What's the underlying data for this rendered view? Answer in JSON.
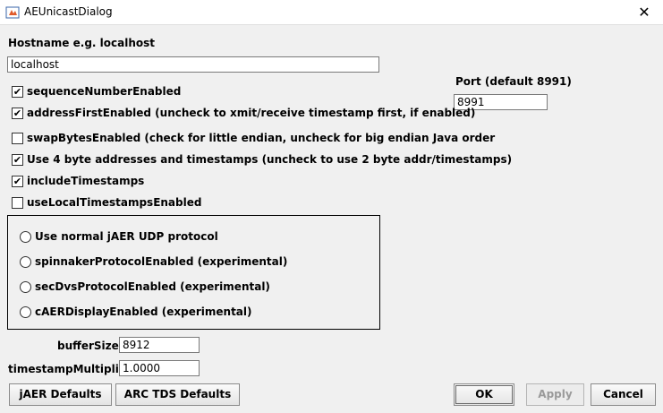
{
  "window": {
    "title": "AEUnicastDialog",
    "close_glyph": "✕"
  },
  "hostname": {
    "label": "Hostname e.g. localhost",
    "value": "localhost"
  },
  "port": {
    "label": "Port (default 8991)",
    "value": "8991"
  },
  "checkboxes": [
    {
      "label": "sequenceNumberEnabled",
      "checked": true
    },
    {
      "label": "addressFirstEnabled (uncheck to xmit/receive timestamp first, if enabled)",
      "checked": true
    },
    {
      "label": "swapBytesEnabled (check for little endian, uncheck for big endian Java order",
      "checked": false
    },
    {
      "label": "Use 4 byte addresses and timestamps (uncheck to use 2 byte addr/timestamps)",
      "checked": true
    },
    {
      "label": "includeTimestamps",
      "checked": true
    },
    {
      "label": "useLocalTimestampsEnabled",
      "checked": false
    }
  ],
  "check_glyph": "✔",
  "protocols": [
    {
      "label": "Use normal jAER UDP protocol",
      "selected": false
    },
    {
      "label": "spinnakerProtocolEnabled (experimental)",
      "selected": false
    },
    {
      "label": "secDvsProtocolEnabled (experimental)",
      "selected": false
    },
    {
      "label": "cAERDisplayEnabled (experimental)",
      "selected": false
    }
  ],
  "buffer_size": {
    "label": "bufferSize",
    "value": "8912"
  },
  "timestamp_multiplier": {
    "label": "timestampMultiplier",
    "value": "1.0000"
  },
  "buttons": {
    "jaer_defaults": "jAER Defaults",
    "arc_tds_defaults": "ARC TDS Defaults",
    "ok": "OK",
    "apply": "Apply",
    "cancel": "Cancel"
  },
  "colors": {
    "icon_accent": "#3a66a8"
  }
}
